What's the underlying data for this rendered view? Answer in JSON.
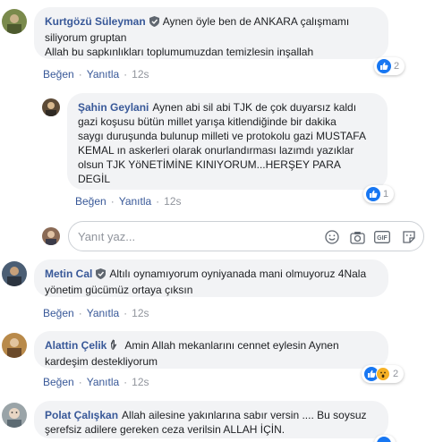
{
  "comments": [
    {
      "author": "Kurtgözü Süleyman",
      "text": "Aynen öyle ben de ANKARA çalışmamı siliyorum gruptan\nAllah bu sapkınlıkları toplumumuzdan temizlesin inşallah",
      "line1": "Aynen öyle ben de ANKARA çalışmamı",
      "line2": "siliyorum gruptan",
      "line3": "Allah bu sapkınlıkları toplumumuzdan temizlesin inşallah",
      "badge": "shield-icon",
      "like_label": "Beğen",
      "reply_label": "Yanıtla",
      "time": "12s",
      "reaction_count": "2"
    },
    {
      "author": "Şahin Geylani",
      "line1": "Aynen abi sil abi TJK de çok duyarsız kaldı",
      "line2": "gazi koşusu bütün millet yarışa kitlendiğinde bir dakika",
      "line3": "saygı duruşunda bulunup milleti ve protokolu gazi MUSTAFA",
      "line4": "KEMAL ın askerleri olarak onurlandırması lazımdı yazıklar",
      "line5": "olsun TJK YöNETİMİNE KINIYORUM...HERŞEY PARA",
      "line6": "DEGİL",
      "like_label": "Beğen",
      "reply_label": "Yanıtla",
      "time": "12s",
      "reaction_count": "1"
    },
    {
      "author": "Metin Cal",
      "line1": "Altılı oynamıyorum oyniyanada mani olmuyoruz 4Nala",
      "line2": "yönetim gücümüz ortaya çıksın",
      "badge": "shield-icon",
      "like_label": "Beğen",
      "reply_label": "Yanıtla",
      "time": "12s"
    },
    {
      "author": "Alattin Çelik",
      "line1": "Amin Allah mekanlarını cennet eylesin Aynen",
      "line2": "kardeşim destekliyorum",
      "badge": "raised-hand-icon",
      "like_label": "Beğen",
      "reply_label": "Yanıtla",
      "time": "12s",
      "reaction_count": "2"
    },
    {
      "author": "Polat Çalışkan",
      "line1": "Allah ailesine yakınlarına sabır versin .... Bu soysuz",
      "line2": "şerefsiz adilere gereken ceza verilsin ALLAH İÇİN."
    }
  ],
  "reply_box": {
    "placeholder": "Yanıt yaz..."
  },
  "colors": {
    "link": "#385898",
    "bubble": "#f2f3f5",
    "meta": "#90949c",
    "like_blue": "#1877f2",
    "wow_yellow": "#f7b125"
  }
}
